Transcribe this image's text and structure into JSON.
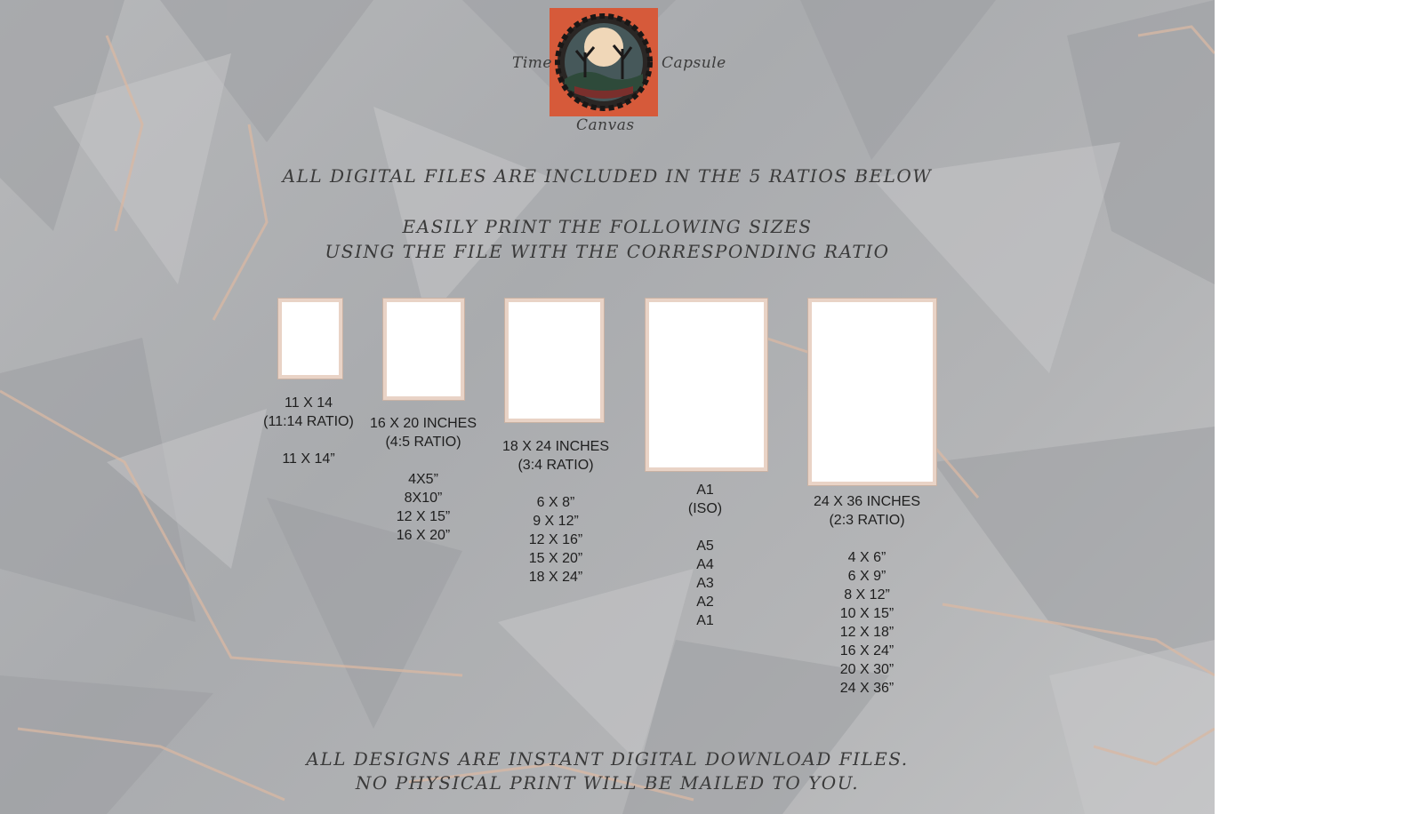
{
  "brand": {
    "word_left": "Time",
    "word_right": "Capsule",
    "word_bottom": "Canvas",
    "logo_colors": {
      "background": "#d65a3a",
      "moon": "#f0d7b8",
      "frame": "#2a2624"
    }
  },
  "headings": {
    "included": "ALL DIGITAL FILES ARE INCLUDED IN THE 5 RATIOS BELOW",
    "print_line1": "EASILY PRINT THE FOLLOWING SIZES",
    "print_line2": "USING THE FILE WITH THE CORRESPONDING RATIO"
  },
  "ratios": [
    {
      "lines": [
        "11 X 14",
        "(11:14 RATIO)",
        "",
        "11 X 14”"
      ]
    },
    {
      "lines": [
        "16 X 20 INCHES",
        "(4:5 RATIO)",
        "",
        "4X5”",
        "8X10”",
        "12 X 15”",
        "16 X 20”"
      ]
    },
    {
      "lines": [
        "18 X 24 INCHES",
        "(3:4 RATIO)",
        "",
        "6 X 8”",
        "9 X 12”",
        "12 X 16”",
        "15 X 20”",
        "18 X 24”"
      ]
    },
    {
      "lines": [
        "A1",
        "(ISO)",
        "",
        "A5",
        "A4",
        "A3",
        "A2",
        "A1"
      ]
    },
    {
      "lines": [
        "24 X 36 INCHES",
        "(2:3 RATIO)",
        "",
        "4 X 6”",
        "6 X 9”",
        "8 X 12”",
        "10 X 15”",
        "12 X 18”",
        "16 X 24”",
        "20 X 30”",
        "24 X 36”"
      ]
    }
  ],
  "footer": {
    "line1": "ALL DESIGNS ARE INSTANT DIGITAL DOWNLOAD FILES.",
    "line2": "NO PHYSICAL PRINT WILL BE MAILED TO YOU."
  },
  "colors": {
    "frame_border": "#e9d3c6",
    "text": "#1e1e1e",
    "background": "#b3b4b6"
  }
}
